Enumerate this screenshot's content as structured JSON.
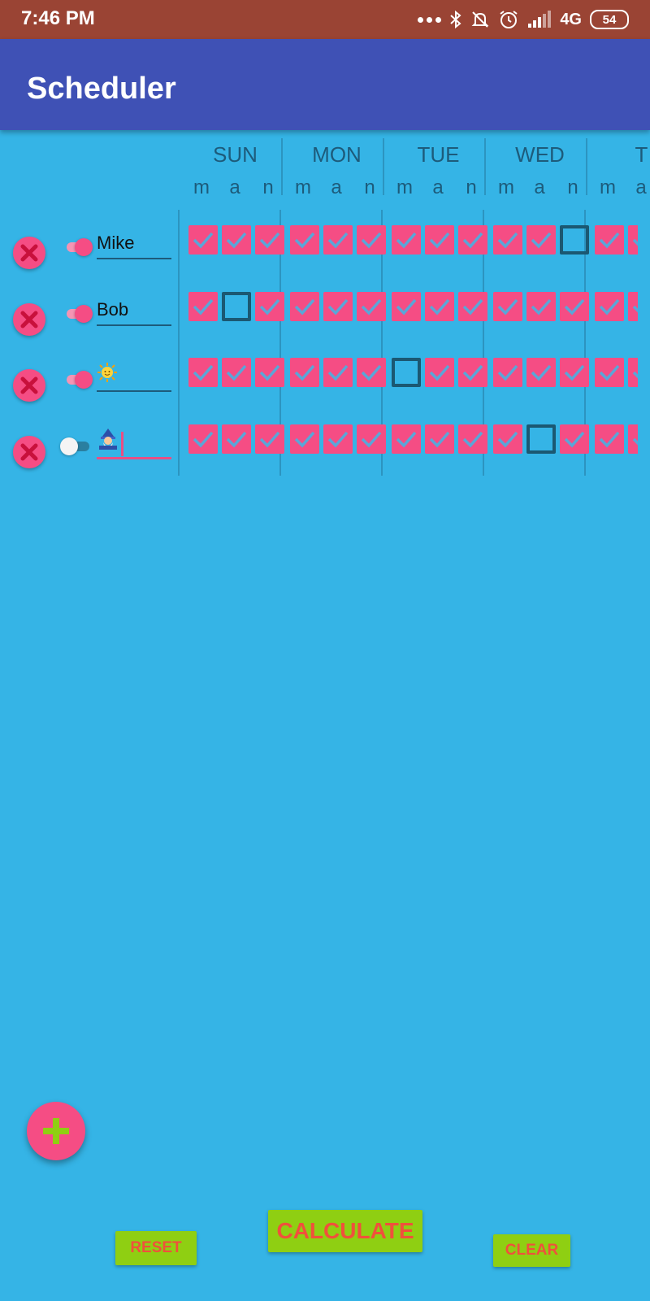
{
  "status_bar": {
    "time": "7:46 PM",
    "network": "4G",
    "battery": "54"
  },
  "app_bar": {
    "title": "Scheduler"
  },
  "days": [
    "SUN",
    "MON",
    "TUE",
    "WED",
    "T"
  ],
  "slots": [
    "m",
    "a",
    "n"
  ],
  "persons": [
    {
      "name": "Mike",
      "enabled": true,
      "emoji": "",
      "focused": false,
      "checks": [
        true,
        true,
        true,
        true,
        true,
        true,
        true,
        true,
        true,
        true,
        true,
        false,
        true,
        true
      ]
    },
    {
      "name": "Bob",
      "enabled": true,
      "emoji": "",
      "focused": false,
      "checks": [
        true,
        false,
        true,
        true,
        true,
        true,
        true,
        true,
        true,
        true,
        true,
        true,
        true,
        true
      ]
    },
    {
      "name": "",
      "enabled": true,
      "emoji": "sun-with-face-icon",
      "focused": false,
      "checks": [
        true,
        true,
        true,
        true,
        true,
        true,
        false,
        true,
        true,
        true,
        true,
        true,
        true,
        true
      ]
    },
    {
      "name": "",
      "enabled": false,
      "emoji": "mage-icon",
      "focused": true,
      "checks": [
        true,
        true,
        true,
        true,
        true,
        true,
        true,
        true,
        true,
        true,
        false,
        true,
        true,
        true
      ]
    }
  ],
  "buttons": {
    "reset": "RESET",
    "calculate": "CALCULATE",
    "clear": "CLEAR"
  },
  "colors": {
    "background": "#35b4e6",
    "status_bar": "#9a4434",
    "app_bar": "#3f51b5",
    "accent": "#f54d84",
    "button": "#8fcf12",
    "button_text": "#f0503c"
  }
}
